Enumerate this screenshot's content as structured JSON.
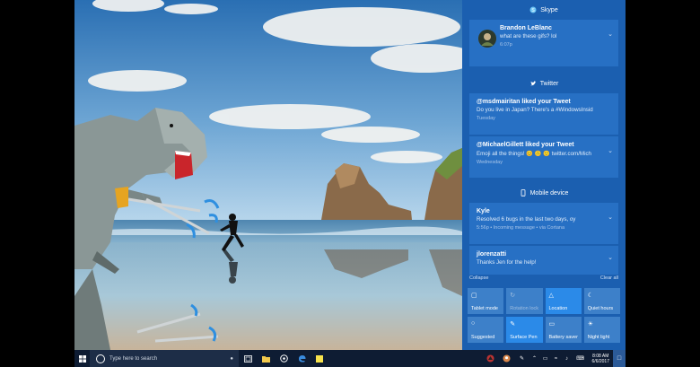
{
  "action_center": {
    "groups": [
      {
        "app": "Skype",
        "icon": "skype-icon"
      },
      {
        "app": "Twitter",
        "icon": "twitter-icon"
      },
      {
        "app": "Mobile device",
        "icon": "phone-icon"
      }
    ],
    "skype": {
      "sender": "Brandon LeBlanc",
      "message": "what are these gifs? lol",
      "time": "6:07p"
    },
    "twitter": [
      {
        "title": "@msdmairitan liked your Tweet",
        "body": "Do you live in Japan? There's a #WindowsInsid",
        "time": "Tuesday"
      },
      {
        "title": "@MichaelGillett liked your Tweet",
        "body": "Emoji all the things! 😊 🙃 🙂 twitter.com/Mich",
        "time": "Wednesday"
      }
    ],
    "mobile": [
      {
        "title": "Kyle",
        "body": "Resolved 6 bugs in the last two days, oy",
        "time": "5:56p • Incoming message • via Cortana"
      },
      {
        "title": "jlorenzatti",
        "body": "Thanks Jen for the help!",
        "time": ""
      }
    ],
    "collapse_label": "Collapse",
    "clear_all_label": "Clear all",
    "quick_actions": [
      {
        "label": "Tablet mode",
        "icon": "tablet-icon",
        "state": "off"
      },
      {
        "label": "Rotation lock",
        "icon": "rotation-lock-icon",
        "state": "disabled"
      },
      {
        "label": "Location",
        "icon": "location-icon",
        "state": "on"
      },
      {
        "label": "Quiet hours",
        "icon": "moon-icon",
        "state": "off"
      },
      {
        "label": "Suggested",
        "icon": "lightbulb-icon",
        "state": "off"
      },
      {
        "label": "Surface Pen",
        "icon": "pen-icon",
        "state": "on"
      },
      {
        "label": "Battery saver",
        "icon": "battery-icon",
        "state": "off"
      },
      {
        "label": "Night light",
        "icon": "sun-icon",
        "state": "off"
      }
    ]
  },
  "taskbar": {
    "search_placeholder": "Type here to search",
    "pinned": [
      {
        "name": "task-view-icon"
      },
      {
        "name": "file-explorer-icon"
      },
      {
        "name": "groove-icon"
      },
      {
        "name": "edge-icon"
      },
      {
        "name": "sticky-notes-icon"
      }
    ],
    "time": "8:08 AM",
    "date": "6/6/2017"
  },
  "colors": {
    "action_center_bg": "#1b5fb0",
    "notification_bg": "#2770c4",
    "tile_on": "#2b8ae8",
    "tile_off": "#3d80c9",
    "taskbar_bg": "#0e1c33"
  }
}
